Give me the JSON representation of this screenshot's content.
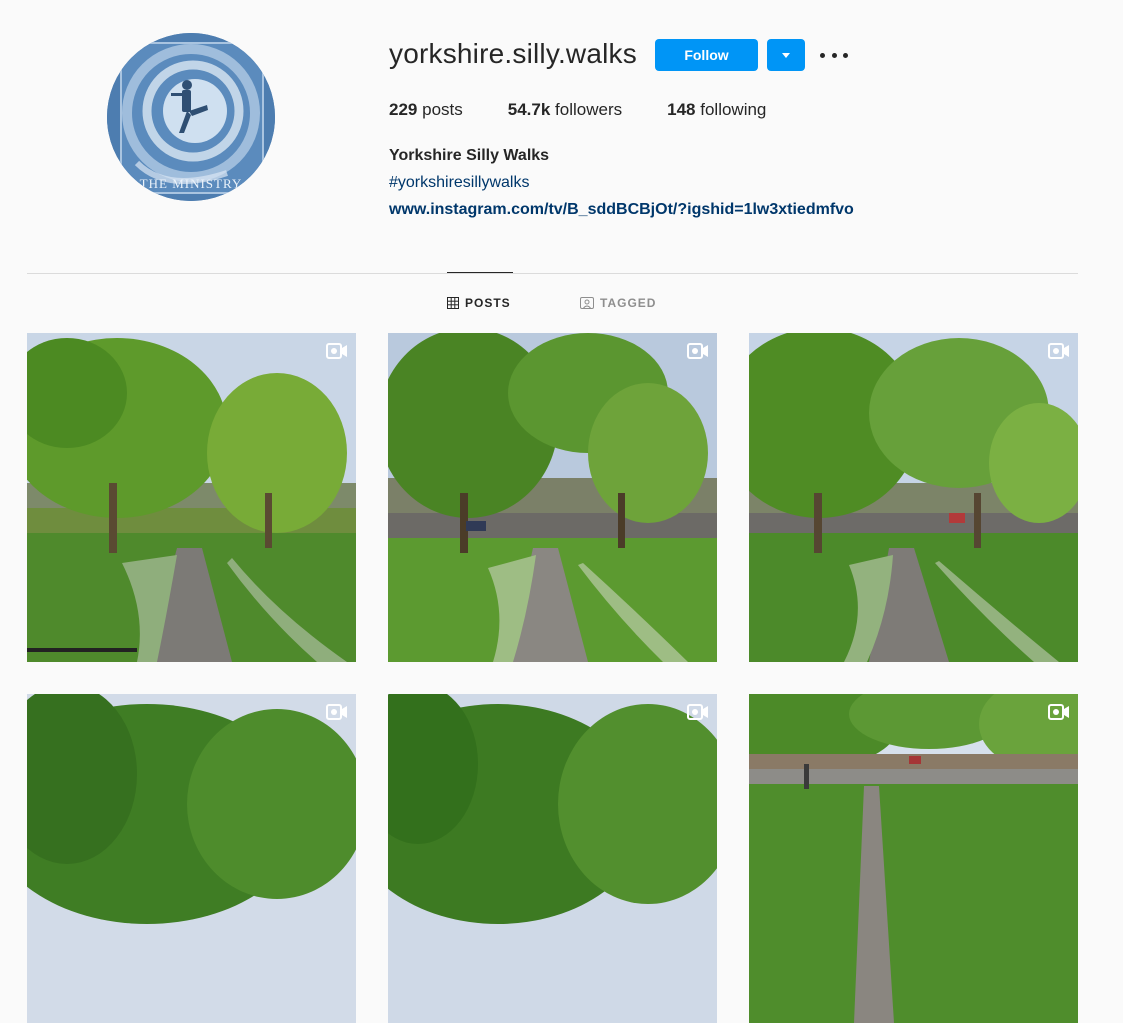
{
  "profile": {
    "username": "yorkshire.silly.walks",
    "follow_label": "Follow",
    "stats": {
      "posts_count": "229",
      "posts_label": "posts",
      "followers_count": "54.7k",
      "followers_label": "followers",
      "following_count": "148",
      "following_label": "following"
    },
    "full_name": "Yorkshire Silly Walks",
    "bio_hashtag": "#yorkshiresillywalks",
    "bio_link": "www.instagram.com/tv/B_sddBCBjOt/?igshid=1lw3xtiedmfvo",
    "avatar_text": "THE MINISTRY"
  },
  "tabs": [
    {
      "label": "POSTS",
      "icon": "grid-icon",
      "active": true
    },
    {
      "label": "TAGGED",
      "icon": "tagged-icon",
      "active": false
    }
  ],
  "posts": [
    {
      "type": "video",
      "icon": "video-icon"
    },
    {
      "type": "video",
      "icon": "video-icon"
    },
    {
      "type": "video",
      "icon": "video-icon"
    },
    {
      "type": "video",
      "icon": "video-icon"
    },
    {
      "type": "video",
      "icon": "video-icon"
    },
    {
      "type": "video",
      "icon": "video-icon"
    }
  ],
  "colors": {
    "accent": "#0095f6",
    "link": "#00376b",
    "text": "#262626",
    "muted": "#8e8e8e",
    "background": "#fafafa"
  }
}
